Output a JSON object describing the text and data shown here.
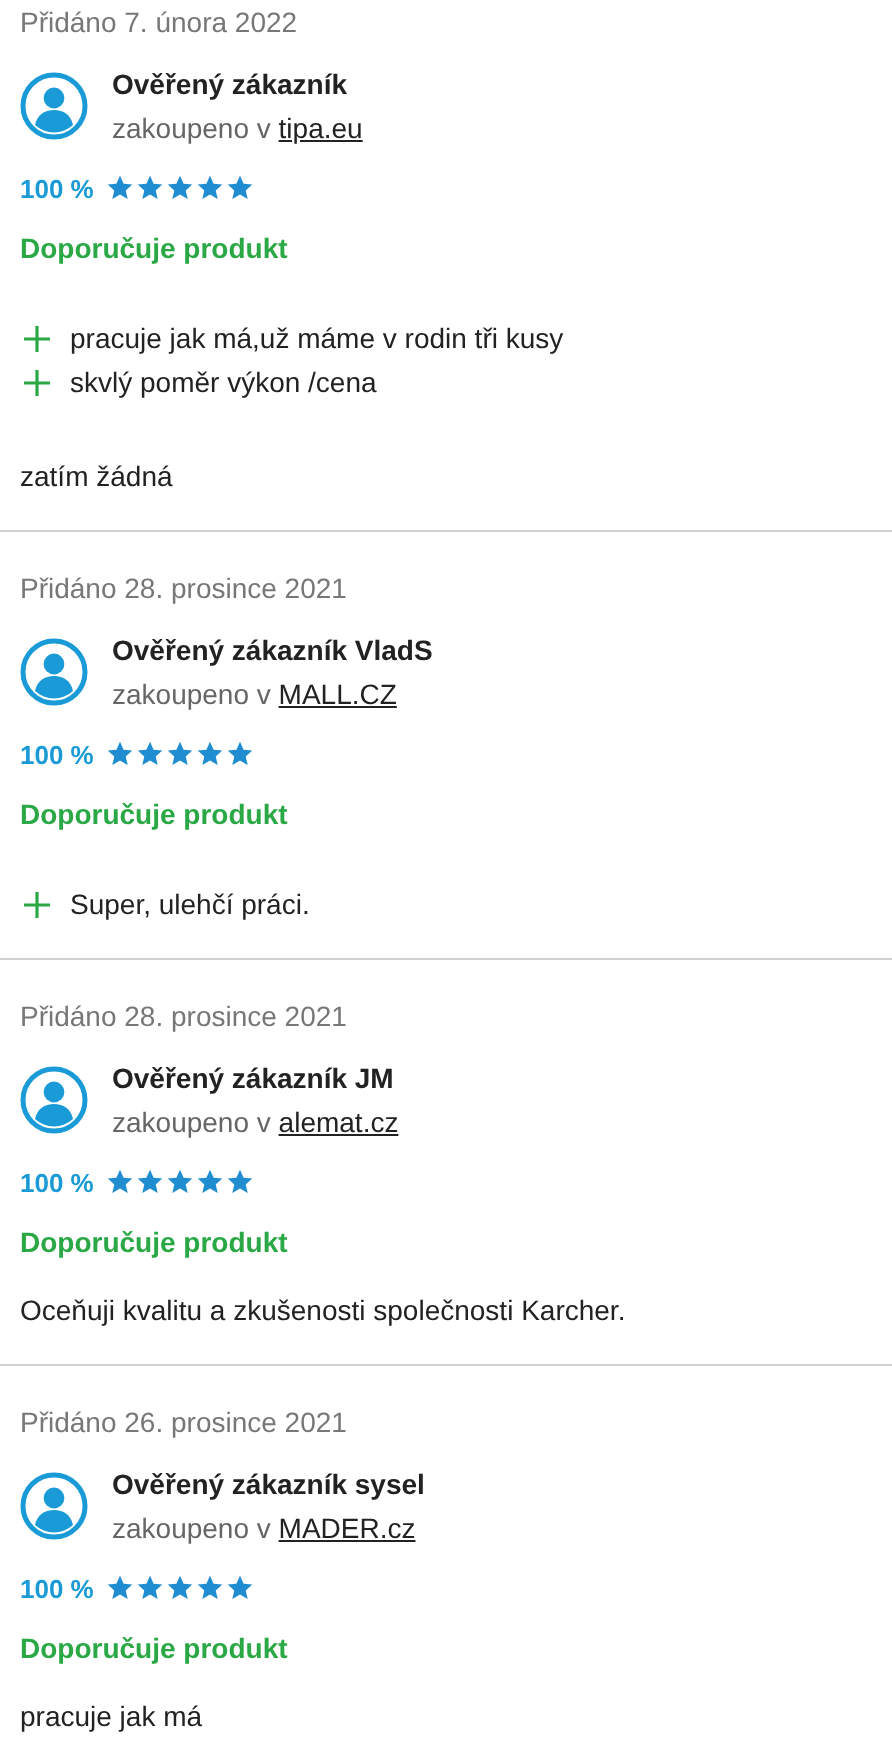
{
  "reviews": [
    {
      "date": "Přidáno 7. února 2022",
      "author": "Ověřený zákazník",
      "purchased": "zakoupeno v",
      "shop": "tipa.eu",
      "rating": "100 %",
      "stars": 5,
      "recommendation": "Doporučuje produkt",
      "pros": [
        "pracuje jak má,už máme v rodin tři kusy",
        "skvlý poměr výkon /cena"
      ],
      "comment": "zatím žádná"
    },
    {
      "date": "Přidáno 28. prosince 2021",
      "author": "Ověřený zákazník VladS",
      "purchased": "zakoupeno v",
      "shop": "MALL.CZ",
      "rating": "100 %",
      "stars": 5,
      "recommendation": "Doporučuje produkt",
      "pros": [
        "Super, ulehčí práci."
      ]
    },
    {
      "date": "Přidáno 28. prosince 2021",
      "author": "Ověřený zákazník JM",
      "purchased": "zakoupeno v",
      "shop": "alemat.cz",
      "rating": "100 %",
      "stars": 5,
      "recommendation": "Doporučuje produkt",
      "comment": "Oceňuji kvalitu a zkušenosti společnosti Karcher."
    },
    {
      "date": "Přidáno 26. prosince 2021",
      "author": "Ověřený zákazník sysel",
      "purchased": "zakoupeno v",
      "shop": "MADER.cz",
      "rating": "100 %",
      "stars": 5,
      "recommendation": "Doporučuje produkt",
      "comment": "pracuje jak má"
    }
  ]
}
